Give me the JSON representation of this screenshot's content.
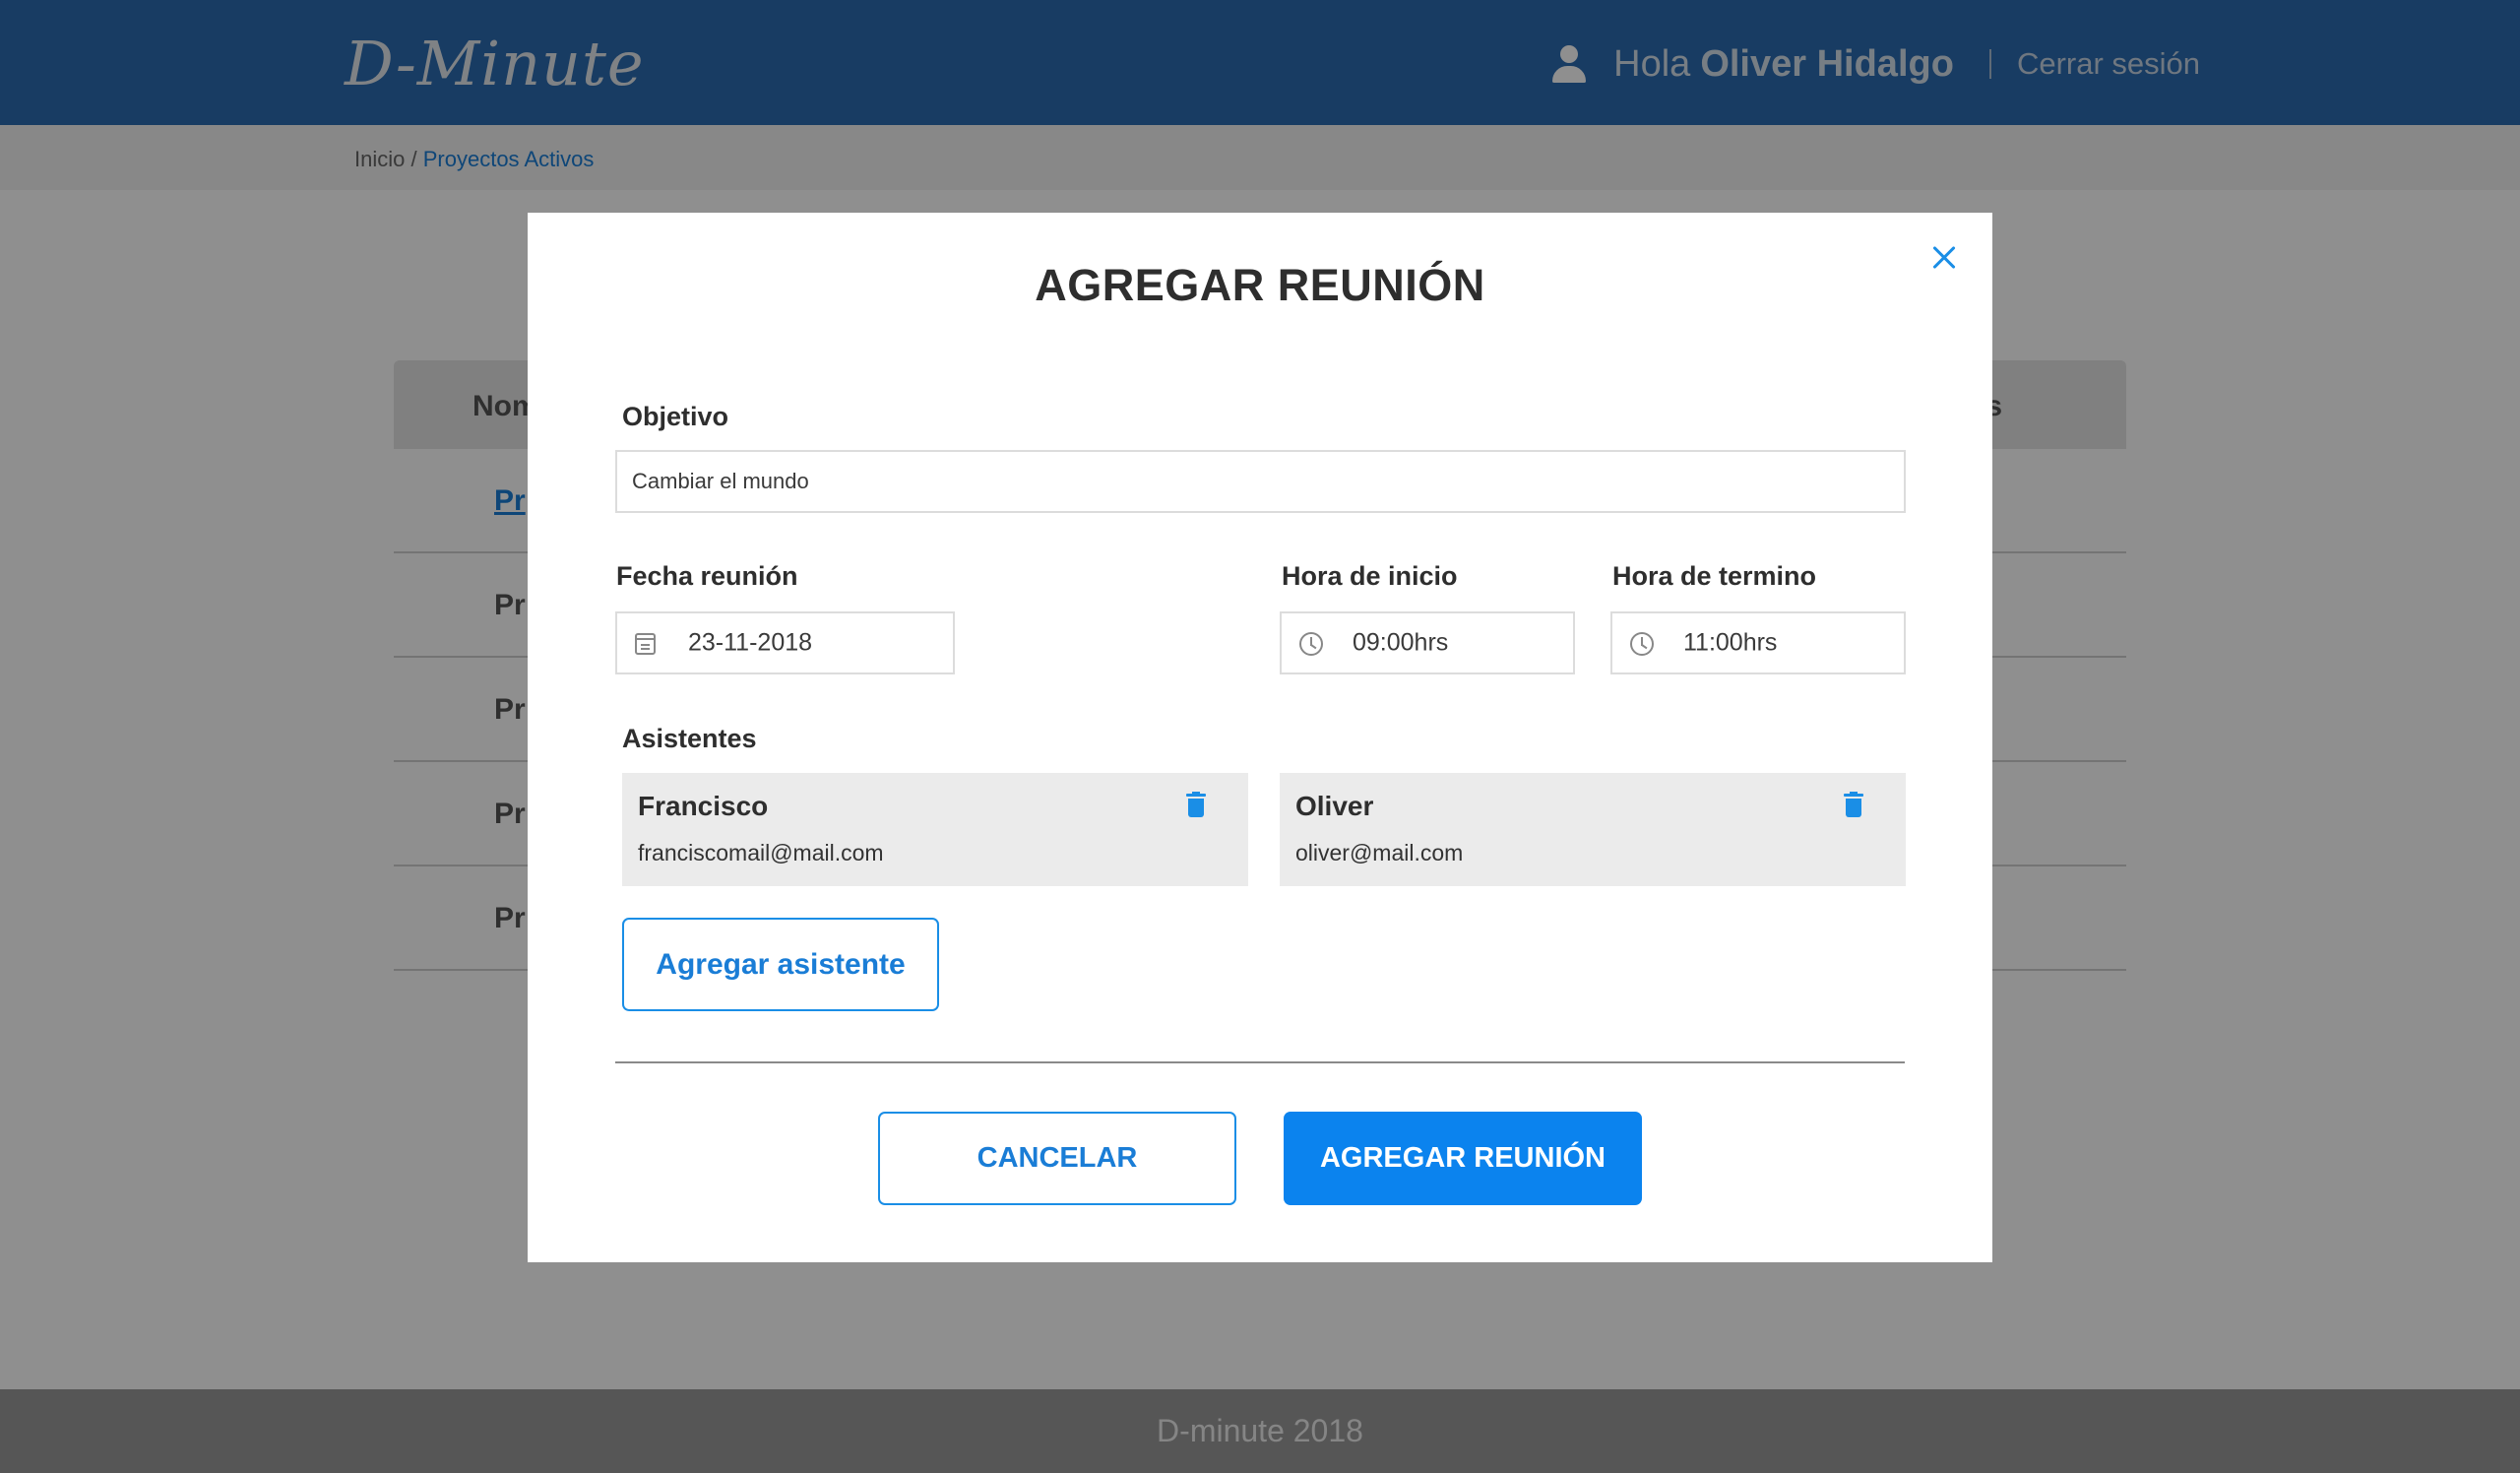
{
  "header": {
    "logo": "D-Minute",
    "greeting": "Hola",
    "user_name": "Oliver Hidalgo",
    "logout": "Cerrar sesión",
    "color": "#2c6bb0"
  },
  "breadcrumb": {
    "home": "Inicio",
    "separator": "/",
    "current": "Proyectos Activos"
  },
  "background_table": {
    "col_left": "Nom",
    "col_right": "s",
    "rows": [
      "Pr",
      "Pr",
      "Pr",
      "Pr",
      "Pr"
    ]
  },
  "modal": {
    "title": "AGREGAR REUNIÓN",
    "objective_label": "Objetivo",
    "objective_value": "Cambiar el mundo",
    "date_label": "Fecha reunión",
    "date_value": "23-11-2018",
    "start_label": "Hora de inicio",
    "start_value": "09:00hrs",
    "end_label": "Hora de termino",
    "end_value": "11:00hrs",
    "attendees_label": "Asistentes",
    "attendees": [
      {
        "name": "Francisco",
        "email": "franciscomail@mail.com"
      },
      {
        "name": "Oliver",
        "email": "oliver@mail.com"
      }
    ],
    "add_attendee_button": "Agregar asistente",
    "cancel_button": "CANCELAR",
    "submit_button": "AGREGAR REUNIÓN",
    "accent_color": "#0b83ee"
  },
  "footer": {
    "text": "D-minute 2018"
  }
}
